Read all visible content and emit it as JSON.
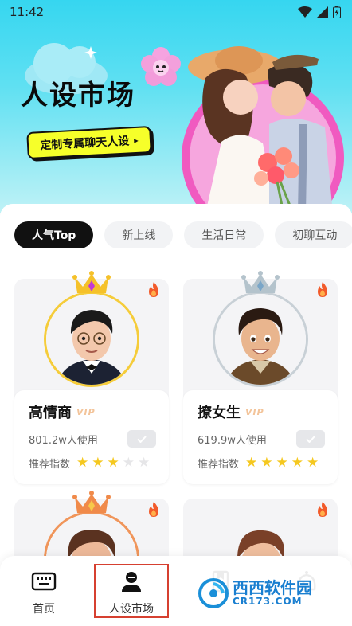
{
  "status_bar": {
    "time": "11:42"
  },
  "hero": {
    "title": "人设市场",
    "cta_label": "定制专属聊天人设",
    "cta_arrow": "▸"
  },
  "tabs": [
    {
      "label": "人气Top",
      "active": true
    },
    {
      "label": "新上线",
      "active": false
    },
    {
      "label": "生活日常",
      "active": false
    },
    {
      "label": "初聊互动",
      "active": false
    }
  ],
  "cards": [
    {
      "name": "高情商",
      "badge": "VIP",
      "usage": "801.2w人使用",
      "rating_label": "推荐指数",
      "rating": 3,
      "crown_color": "#f5c12a",
      "ring_color": "#f5cc3a"
    },
    {
      "name": "撩女生",
      "badge": "VIP",
      "usage": "619.9w人使用",
      "rating_label": "推荐指数",
      "rating": 5,
      "crown_color": "#aebec8",
      "ring_color": "#c8d0d6"
    },
    {
      "crown_color": "#f08a4a",
      "ring_color": "#f0955a"
    },
    {
      "crown_color": null,
      "ring_color": null
    }
  ],
  "bottom_nav": [
    {
      "label": "首页",
      "icon": "keyboard-icon"
    },
    {
      "label": "人设市场",
      "icon": "person-icon",
      "active": true
    },
    {
      "label": "",
      "icon": "bookmark-icon"
    },
    {
      "label": "",
      "icon": "profile-icon"
    }
  ],
  "watermark": {
    "brand": "西西软件园",
    "url": "CR173.COM"
  },
  "colors": {
    "accent_yellow": "#f6ff2a",
    "star": "#f5c81f",
    "active_tab": "#111111",
    "hero_top": "#36d6f0"
  }
}
